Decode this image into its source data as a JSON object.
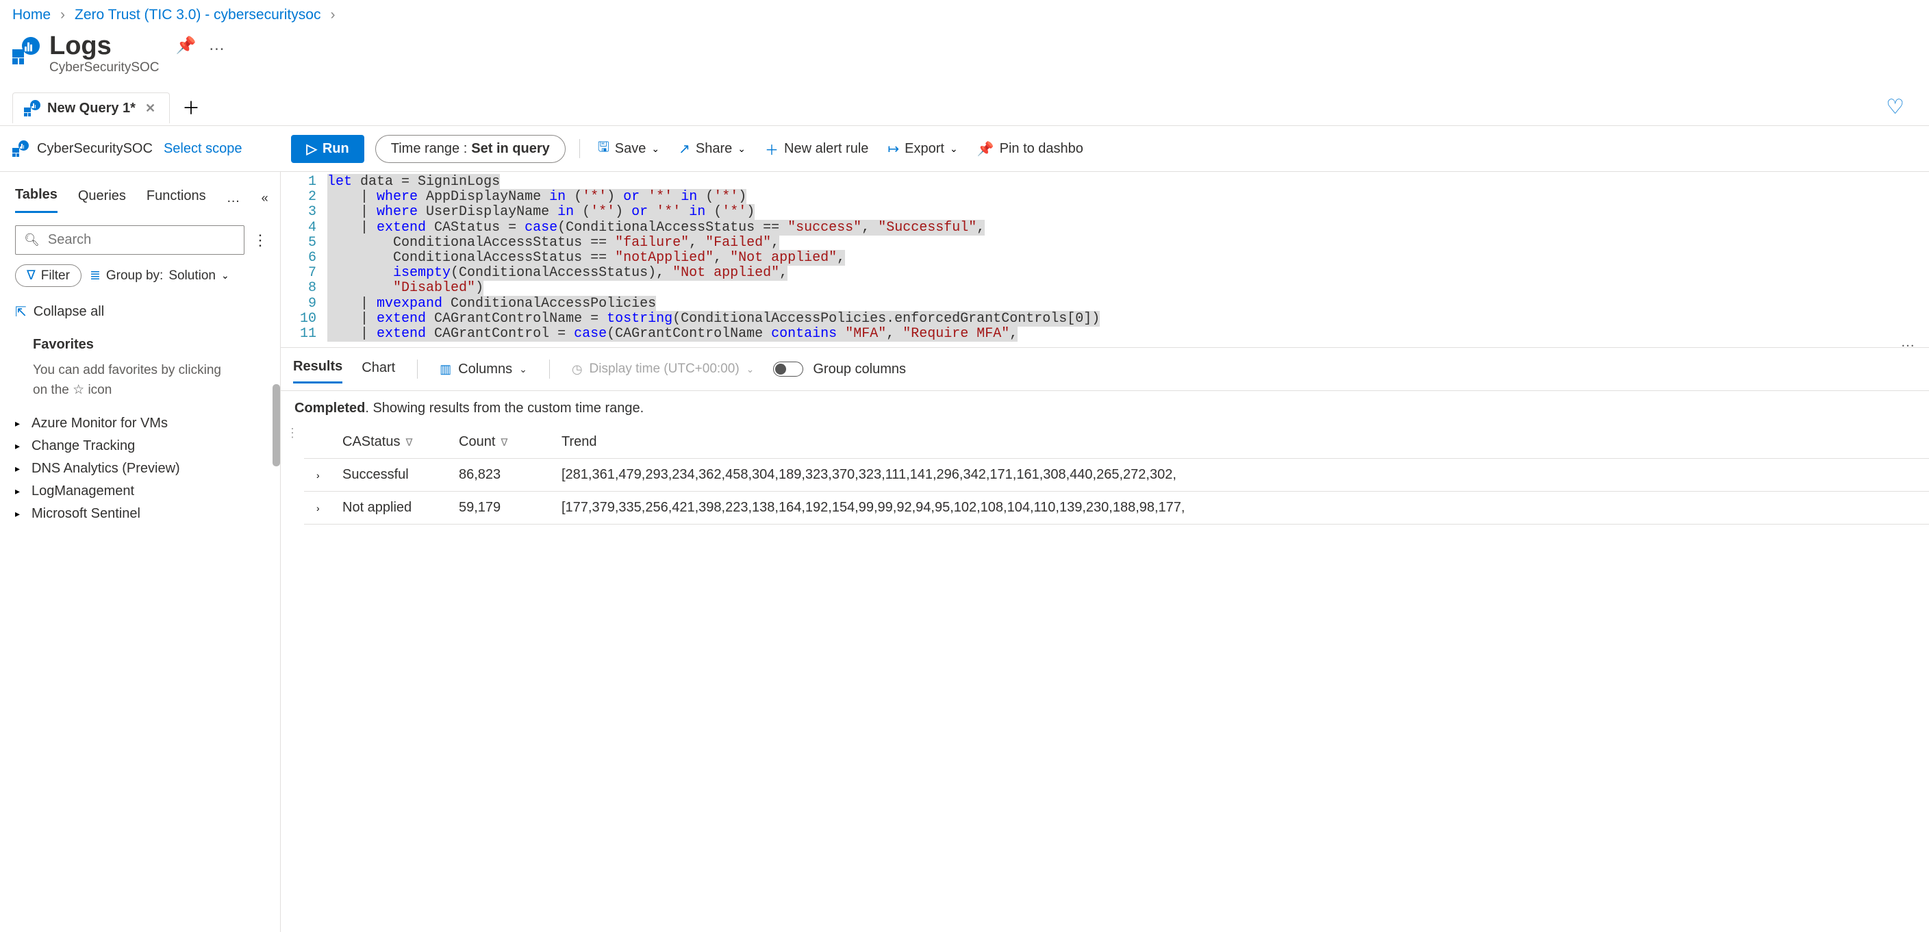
{
  "breadcrumb": [
    "Home",
    "Zero Trust (TIC 3.0) - cybersecuritysoc"
  ],
  "header": {
    "title": "Logs",
    "subtitle": "CyberSecuritySOC"
  },
  "tab": {
    "label": "New Query 1*"
  },
  "toolbar": {
    "workspace": "CyberSecuritySOC",
    "select_scope": "Select scope",
    "run": "Run",
    "time_range_lbl": "Time range :",
    "time_range_val": "Set in query",
    "save": "Save",
    "share": "Share",
    "new_alert": "New alert rule",
    "export": "Export",
    "pin": "Pin to dashbo"
  },
  "sidebar": {
    "tabs": [
      "Tables",
      "Queries",
      "Functions"
    ],
    "search_placeholder": "Search",
    "filter": "Filter",
    "groupby_lbl": "Group by:",
    "groupby_val": "Solution",
    "collapse": "Collapse all",
    "favorites_title": "Favorites",
    "favorites_text_1": "You can add favorites by clicking",
    "favorites_text_2": "on the",
    "favorites_text_3": "icon",
    "tree": [
      "Azure Monitor for VMs",
      "Change Tracking",
      "DNS Analytics (Preview)",
      "LogManagement",
      "Microsoft Sentinel"
    ]
  },
  "editor": {
    "line1": [
      "let",
      " data = SigninLogs"
    ],
    "line2": [
      "    | ",
      "where",
      " AppDisplayName ",
      "in",
      " (",
      "'*'",
      ") ",
      "or",
      " ",
      "'*'",
      " ",
      "in",
      " (",
      "'*'",
      ")"
    ],
    "line3": [
      "    | ",
      "where",
      " UserDisplayName ",
      "in",
      " (",
      "'*'",
      ") ",
      "or",
      " ",
      "'*'",
      " ",
      "in",
      " (",
      "'*'",
      ")"
    ],
    "line4": [
      "    | ",
      "extend",
      " CAStatus = ",
      "case",
      "(ConditionalAccessStatus == ",
      "\"success\"",
      ", ",
      "\"Successful\"",
      ","
    ],
    "line5": [
      "        ConditionalAccessStatus == ",
      "\"failure\"",
      ", ",
      "\"Failed\"",
      ","
    ],
    "line6": [
      "        ConditionalAccessStatus == ",
      "\"notApplied\"",
      ", ",
      "\"Not applied\"",
      ","
    ],
    "line7": [
      "        ",
      "isempty",
      "(ConditionalAccessStatus), ",
      "\"Not applied\"",
      ","
    ],
    "line8": [
      "        ",
      "\"Disabled\"",
      ")"
    ],
    "line9": [
      "    | ",
      "mvexpand",
      " ConditionalAccessPolicies"
    ],
    "line10": [
      "    | ",
      "extend",
      " CAGrantControlName = ",
      "tostring",
      "(ConditionalAccessPolicies.enforcedGrantControls[",
      "0",
      "])"
    ],
    "line11": [
      "    | ",
      "extend",
      " CAGrantControl = ",
      "case",
      "(CAGrantControlName ",
      "contains",
      " ",
      "\"MFA\"",
      ", ",
      "\"Require MFA\"",
      ","
    ]
  },
  "results": {
    "tab_results": "Results",
    "tab_chart": "Chart",
    "columns": "Columns",
    "display_time": "Display time (UTC+00:00)",
    "group_columns": "Group columns",
    "status_b": "Completed",
    "status_r": ". Showing results from the custom time range.",
    "cols": [
      "",
      "CAStatus",
      "Count",
      "Trend"
    ],
    "rows": [
      {
        "CAStatus": "Successful",
        "Count": "86,823",
        "Trend": "[281,361,479,293,234,362,458,304,189,323,370,323,111,141,296,342,171,161,308,440,265,272,302,"
      },
      {
        "CAStatus": "Not applied",
        "Count": "59,179",
        "Trend": "[177,379,335,256,421,398,223,138,164,192,154,99,99,92,94,95,102,108,104,110,139,230,188,98,177,"
      }
    ]
  }
}
